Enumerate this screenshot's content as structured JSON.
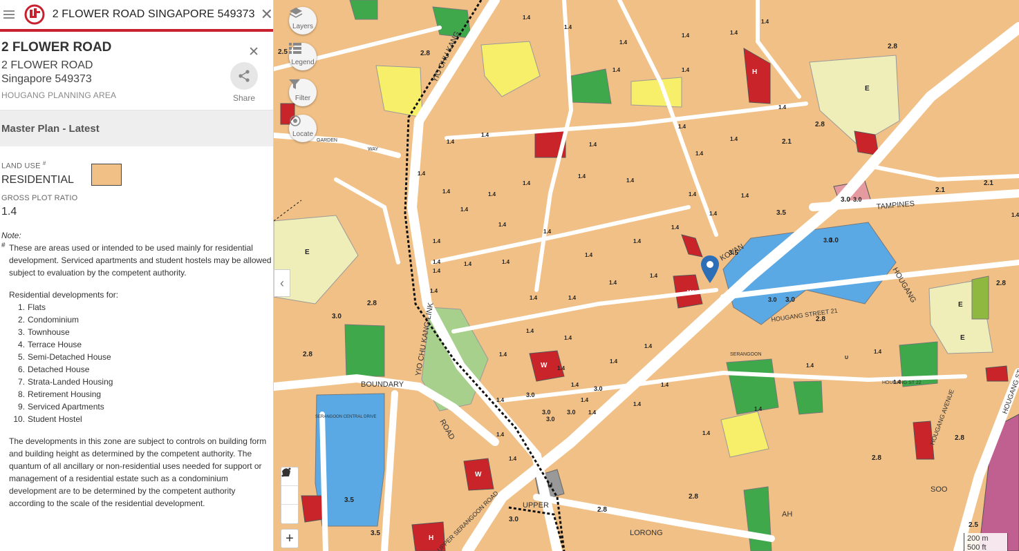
{
  "search": {
    "query": "2 FLOWER ROAD SINGAPORE 549373"
  },
  "address": {
    "title": "2 FLOWER ROAD",
    "line1": "2 FLOWER ROAD",
    "line2": "Singapore 549373",
    "planning_area": "HOUGANG PLANNING AREA",
    "share_label": "Share"
  },
  "master_plan": {
    "title": "Master Plan - Latest",
    "land_use_label": "LAND USE",
    "land_use_mark": "#",
    "land_use_value": "RESIDENTIAL",
    "land_use_color": "#f1c086",
    "gpr_label": "GROSS PLOT RATIO",
    "gpr_value": "1.4"
  },
  "note": {
    "title": "Note:",
    "hash": "#",
    "text": "These are areas used or intended to be used mainly for residential development. Serviced apartments and student hostels may be allowed subject to evaluation by the competent authority.",
    "list_title": "Residential developments for:",
    "list": [
      {
        "num": "1.",
        "label": "Flats"
      },
      {
        "num": "2.",
        "label": "Condominium"
      },
      {
        "num": "3.",
        "label": "Townhouse"
      },
      {
        "num": "4.",
        "label": "Terrace House"
      },
      {
        "num": "5.",
        "label": "Semi-Detached House"
      },
      {
        "num": "6.",
        "label": "Detached House"
      },
      {
        "num": "7.",
        "label": "Strata-Landed Housing"
      },
      {
        "num": "8.",
        "label": "Retirement Housing"
      },
      {
        "num": "9.",
        "label": "Serviced Apartments"
      },
      {
        "num": "10.",
        "label": "Student Hostel"
      }
    ],
    "controls": "The developments in this zone are subject to controls on building form and building height as determined by the competent authority. The quantum of all ancillary or non-residential uses needed for support or management of a residential estate such as a condominium development are to be determined by the competent authority according to the scale of the residential development."
  },
  "map": {
    "buttons": {
      "layers": "Layers",
      "legend": "Legend",
      "filter": "Filter",
      "locate": "Locate"
    },
    "scale": {
      "a": "200 m",
      "b": "500 ft"
    },
    "colors": {
      "residential": "#f1c086",
      "commercial": "#c8242a",
      "park": "#3fa84b",
      "open_space": "#a8d08d",
      "education": "#f0eeb8",
      "civic": "#f7ef6a",
      "business": "#5aa9e4",
      "reserve": "#999999",
      "road": "#ffffff",
      "mixed": "#e59aa0"
    },
    "road_labels": [
      "YIO CHU KANG",
      "YIO CHU KANG LINK",
      "BOUNDARY",
      "ROAD",
      "UPPER SERANGOON ROAD",
      "SERANGOON",
      "KOVAN",
      "TAMPINES",
      "HOUGANG",
      "HOUGANG STREET 21",
      "HOUGANG AVENUE",
      "LORONG",
      "AH",
      "SOO",
      "GARDEN",
      "WAY",
      "UPPER",
      "SERANGOON CENTRAL DRIVE",
      "HOUGANG ST 22"
    ],
    "plot_ratios": [
      "1.4",
      "2.8",
      "3.0",
      "3.5",
      "2.1",
      "2.5",
      "E",
      "W",
      "H",
      "U"
    ]
  }
}
